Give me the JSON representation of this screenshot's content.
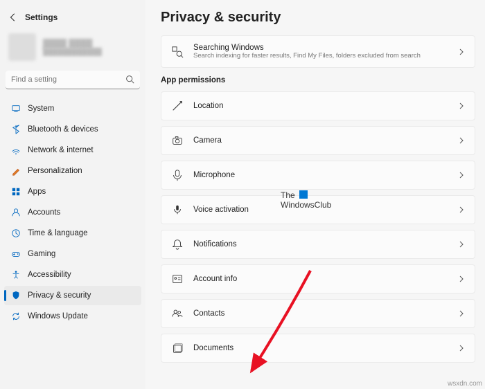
{
  "app_title": "Settings",
  "user": {
    "name": "████ ████",
    "email": "████████████"
  },
  "search": {
    "placeholder": "Find a setting"
  },
  "nav": [
    {
      "label": "System",
      "icon": "system"
    },
    {
      "label": "Bluetooth & devices",
      "icon": "bluetooth"
    },
    {
      "label": "Network & internet",
      "icon": "network"
    },
    {
      "label": "Personalization",
      "icon": "personalization"
    },
    {
      "label": "Apps",
      "icon": "apps"
    },
    {
      "label": "Accounts",
      "icon": "accounts"
    },
    {
      "label": "Time & language",
      "icon": "time"
    },
    {
      "label": "Gaming",
      "icon": "gaming"
    },
    {
      "label": "Accessibility",
      "icon": "accessibility"
    },
    {
      "label": "Privacy & security",
      "icon": "privacy",
      "active": true
    },
    {
      "label": "Windows Update",
      "icon": "update"
    }
  ],
  "page": {
    "title": "Privacy & security",
    "top_card": {
      "title": "Searching Windows",
      "sub": "Search indexing for faster results, Find My Files, folders excluded from search"
    },
    "section_label": "App permissions",
    "items": [
      {
        "label": "Location",
        "icon": "location"
      },
      {
        "label": "Camera",
        "icon": "camera"
      },
      {
        "label": "Microphone",
        "icon": "microphone"
      },
      {
        "label": "Voice activation",
        "icon": "voice"
      },
      {
        "label": "Notifications",
        "icon": "bell"
      },
      {
        "label": "Account info",
        "icon": "account-info"
      },
      {
        "label": "Contacts",
        "icon": "contacts"
      },
      {
        "label": "Documents",
        "icon": "documents"
      }
    ]
  },
  "watermark": {
    "line1": "The",
    "line2": "WindowsClub"
  },
  "footer": "wsxdn.com"
}
